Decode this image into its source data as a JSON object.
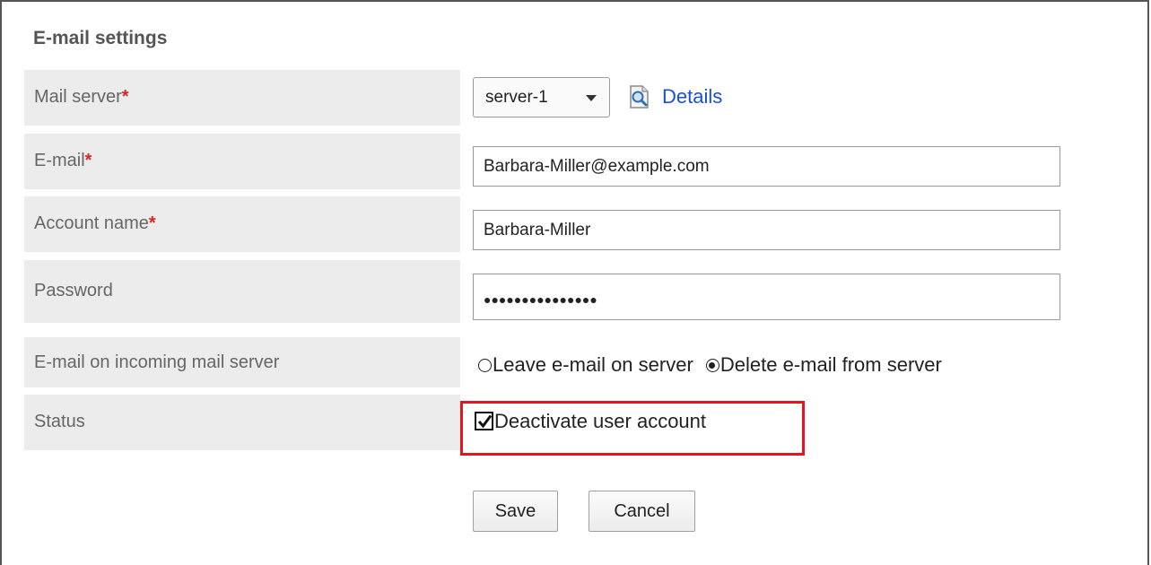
{
  "section": {
    "title": "E-mail settings"
  },
  "fields": {
    "mail_server": {
      "label": "Mail server",
      "required_mark": "*",
      "selected": "server-1",
      "details_label": "Details"
    },
    "email": {
      "label": "E-mail",
      "required_mark": "*",
      "value": "Barbara-Miller@example.com"
    },
    "account_name": {
      "label": "Account name",
      "required_mark": "*",
      "value": "Barbara-Miller"
    },
    "password": {
      "label": "Password",
      "value": "●●●●●●●●●●●●●●●"
    },
    "incoming": {
      "label": "E-mail on incoming mail server",
      "options": [
        {
          "label": "Leave e-mail on server",
          "checked": false
        },
        {
          "label": "Delete e-mail from server",
          "checked": true
        }
      ]
    },
    "status": {
      "label": "Status",
      "checkbox_label": "Deactivate user account",
      "checked": true
    }
  },
  "buttons": {
    "save": "Save",
    "cancel": "Cancel"
  },
  "colors": {
    "label_bg": "#ececec",
    "required": "#dd2222",
    "link": "#1a4fd1",
    "highlight": "#e8141b"
  },
  "icons": {
    "details": "magnifier-document-icon",
    "select_caret": "caret-down-icon",
    "checkbox": "checkmark-icon"
  }
}
